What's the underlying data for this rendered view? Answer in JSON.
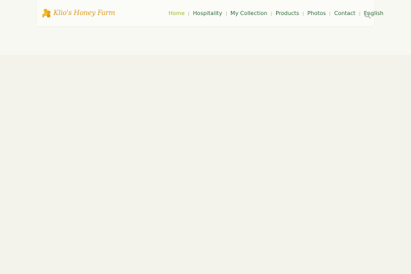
{
  "header": {
    "logo": {
      "text": "Klio's Honey Farm",
      "icon": "honeycomb-icon",
      "color": "#d89a1e"
    },
    "nav": {
      "items": [
        {
          "label": "Home",
          "active": true
        },
        {
          "label": "Hospitality",
          "active": false
        },
        {
          "label": "My Collection",
          "active": false
        },
        {
          "label": "Products",
          "active": false
        },
        {
          "label": "Photos",
          "active": false
        },
        {
          "label": "Contact",
          "active": false
        },
        {
          "label": "English",
          "active": false
        }
      ],
      "separator": "|",
      "active_color": "#9cbb2e",
      "link_color": "#2f6a3a"
    },
    "search": {
      "icon": "search-icon"
    }
  },
  "page": {
    "background": "#f3f3ec"
  }
}
